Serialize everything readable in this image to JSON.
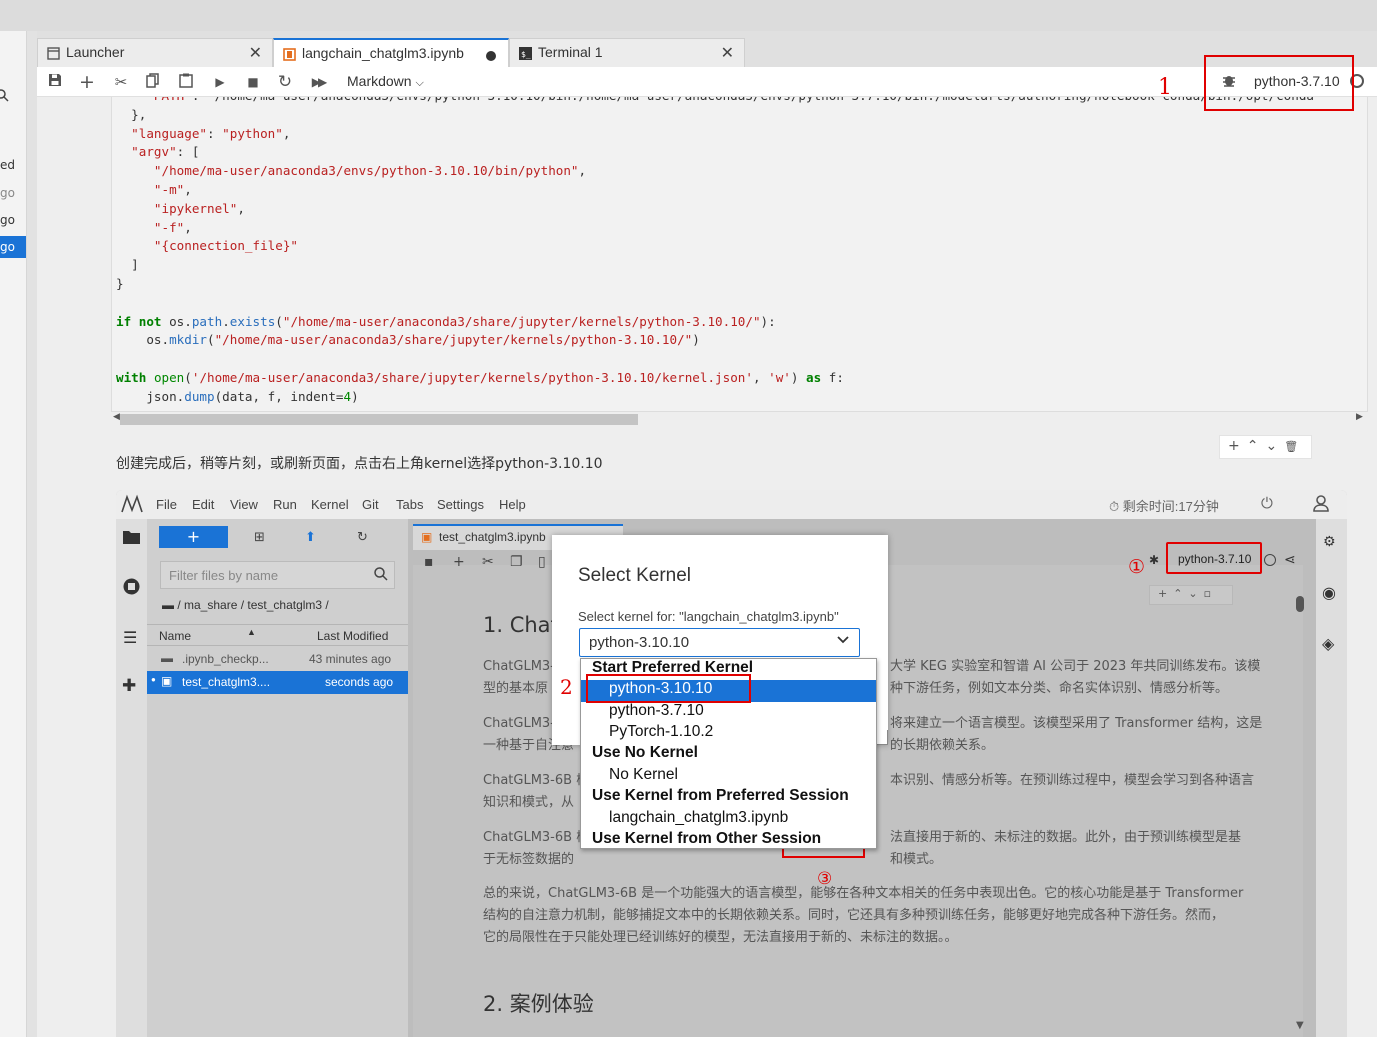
{
  "left_panel": {
    "items": [
      "ed",
      "go",
      "go",
      "go"
    ]
  },
  "tabs": [
    {
      "label": "Launcher",
      "active": false
    },
    {
      "label": "langchain_chatglm3.ipynb",
      "active": true
    },
    {
      "label": "Terminal 1",
      "active": false
    }
  ],
  "toolbar": {
    "cell_type": "Markdown",
    "kernel": "python-3.7.10"
  },
  "code_lines": [
    "    \"PATH\": \"/home/ma-user/anaconda3/envs/python-3.10.10/bin:/home/ma-user/anaconda3/envs/python-3.7.10/bin:/modelarts/authoring/notebook-conda/bin:/opt/conda",
    "  },",
    "  \"language\": \"python\",",
    "  \"argv\": [",
    "     \"/home/ma-user/anaconda3/envs/python-3.10.10/bin/python\",",
    "     \"-m\",",
    "     \"ipykernel\",",
    "     \"-f\",",
    "     \"{connection_file}\"",
    "  ]",
    "}",
    "",
    "if not os.path.exists(\"/home/ma-user/anaconda3/share/jupyter/kernels/python-3.10.10/\"):",
    "    os.mkdir(\"/home/ma-user/anaconda3/share/jupyter/kernels/python-3.10.10/\")",
    "",
    "with open('/home/ma-user/anaconda3/share/jupyter/kernels/python-3.10.10/kernel.json', 'w') as f:",
    "    json.dump(data, f, indent=4)"
  ],
  "markdown_text": "创建完成后，稍等片刻，或刷新页面，点击右上角kernel选择python-3.10.10",
  "embedded": {
    "menu": [
      "File",
      "Edit",
      "View",
      "Run",
      "Kernel",
      "Git",
      "Tabs",
      "Settings",
      "Help"
    ],
    "timer": "剩余时间:17分钟",
    "filter_placeholder": "Filter files by name",
    "breadcrumb": "/ ma_share / test_chatglm3 /",
    "col_name": "Name",
    "col_modified": "Last Modified",
    "files": [
      {
        "name": ".ipynb_checkp...",
        "modified": "43 minutes ago",
        "selected": false
      },
      {
        "name": "test_chatglm3....",
        "modified": "seconds ago",
        "selected": true
      }
    ],
    "tab": "test_chatglm3.ipynb",
    "kernel": "python-3.7.10",
    "heading1": "1. Chat",
    "heading2": "2. 案例体验",
    "para_left": [
      "ChatGLM3-",
      "型的基本原",
      "ChatGLM3-",
      "一种基于自注意",
      "ChatGLM3-6B 模",
      "知识和模式，从",
      "ChatGLM3-6B 模",
      "于无标签数据的"
    ],
    "para_right": [
      "大学 KEG 实验室和智谱 AI 公司于 2023 年共同训练发布。该模",
      "种下游任务，例如文本分类、命名实体识别、情感分析等。",
      "将来建立一个语言模型。该模型采用了 Transformer 结构，这是",
      "的长期依赖关系。",
      "本识别、情感分析等。在预训练过程中，模型会学习到各种语言",
      "法直接用于新的、未标注的数据。此外，由于预训练模型是基",
      "和模式。"
    ],
    "summary": [
      "总的来说，ChatGLM3-6B 是一个功能强大的语言模型，能够在各种文本相关的任务中表现出色。它的核心功能是基于 Transformer",
      "结构的自注意力机制，能够捕捉文本中的长期依赖关系。同时，它还具有多种预训练任务，能够更好地完成各种下游任务。然而，",
      "它的局限性在于只能处理已经训练好的模型，无法直接用于新的、未标注的数据。。"
    ]
  },
  "dialog": {
    "title": "Select Kernel",
    "label": "Select kernel for: \"langchain_chatglm3.ipynb\"",
    "selected": "python-3.10.10",
    "groups": [
      {
        "header": "Start Preferred Kernel",
        "items": [
          "python-3.10.10",
          "python-3.7.10",
          "PyTorch-1.10.2"
        ]
      },
      {
        "header": "Use No Kernel",
        "items": [
          "No Kernel"
        ]
      },
      {
        "header": "Use Kernel from Preferred Session",
        "items": [
          "langchain_chatglm3.ipynb"
        ]
      },
      {
        "header": "Use Kernel from Other Session",
        "items": []
      }
    ]
  },
  "annotations": {
    "n1": "1",
    "n2": "2",
    "c1": "①",
    "c3": "③"
  },
  "colors": {
    "accent": "#1a73d6",
    "annotation": "#e00000"
  }
}
